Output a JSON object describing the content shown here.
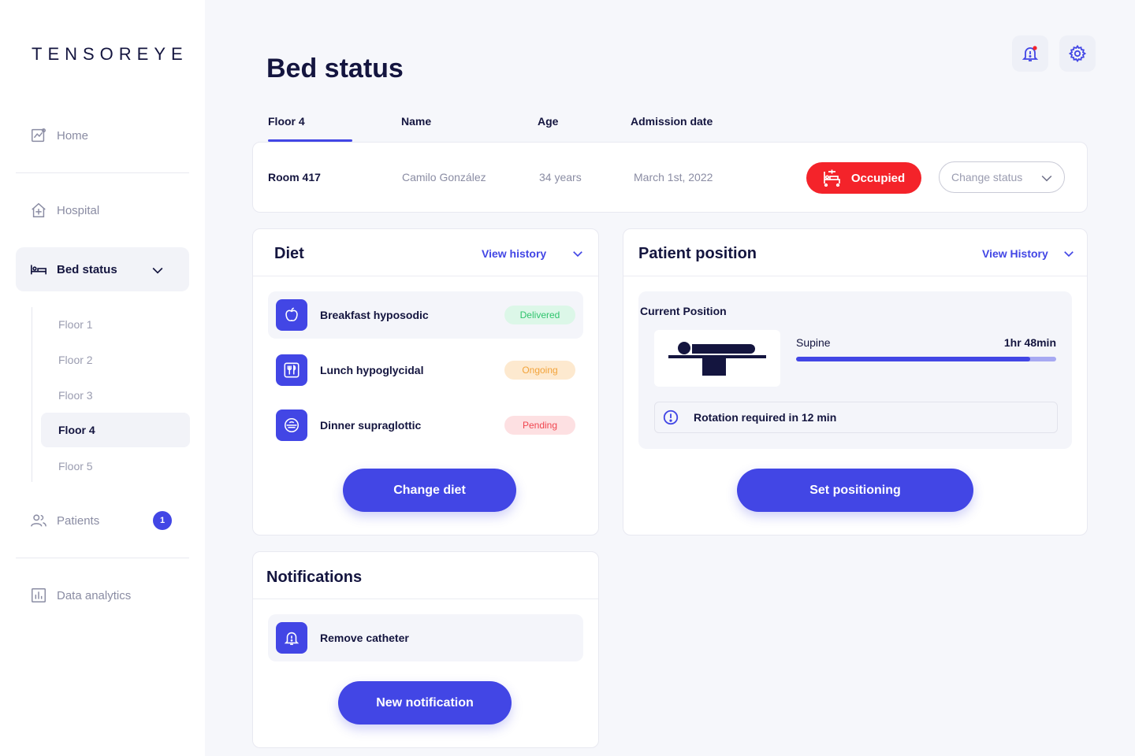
{
  "brand": {
    "logo": "TENSOREYE"
  },
  "sidebar": {
    "home": "Home",
    "hospital": "Hospital",
    "bed_status": "Bed status",
    "floors": [
      "Floor 1",
      "Floor 2",
      "Floor 3",
      "Floor 4",
      "Floor 5"
    ],
    "active_floor": "Floor 4",
    "patients": "Patients",
    "patients_badge": "1",
    "data_analytics": "Data analytics"
  },
  "header": {
    "title": "Bed status"
  },
  "table": {
    "columns": [
      "Floor 4",
      "Name",
      "Age",
      "Admission date"
    ],
    "row": {
      "room": "Room 417",
      "name": "Camilo González",
      "age": "34 years",
      "admission": "March 1st, 2022",
      "status": "Occupied",
      "change_status_placeholder": "Change status"
    }
  },
  "diet": {
    "title": "Diet",
    "link": "View history",
    "items": [
      {
        "label": "Breakfast hyposodic",
        "status": "Delivered",
        "icon": "apple-icon"
      },
      {
        "label": "Lunch hypoglycidal",
        "status": "Ongoing",
        "icon": "fork-knife-icon"
      },
      {
        "label": "Dinner supraglottic",
        "status": "Pending",
        "icon": "bowl-icon"
      }
    ],
    "button": "Change diet"
  },
  "position": {
    "title": "Patient position",
    "link": "View History",
    "current_heading": "Current Position",
    "name": "Supine",
    "duration": "1hr 48min",
    "progress_fraction": 0.9,
    "alert": "Rotation required in 12 min",
    "button": "Set positioning"
  },
  "notifications": {
    "title": "Notifications",
    "items": [
      {
        "label": "Remove catheter",
        "icon": "bell-alert-icon"
      }
    ],
    "button": "New notification"
  },
  "colors": {
    "accent": "#4246e5",
    "occupied": "#f4232a",
    "delivered_bg": "#dcf7e8",
    "delivered_text": "#2fc46d",
    "ongoing_bg": "#fde9cf",
    "ongoing_text": "#f2a33a",
    "pending_bg": "#fde0e2",
    "pending_text": "#f0464f"
  }
}
